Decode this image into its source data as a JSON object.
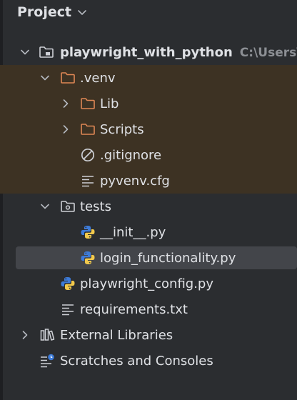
{
  "panel": {
    "title": "Project"
  },
  "tree": {
    "root": {
      "label": "playwright_with_python",
      "path_hint": "C:\\Users\\"
    },
    "venv": {
      "label": ".venv"
    },
    "lib": {
      "label": "Lib"
    },
    "scripts": {
      "label": "Scripts"
    },
    "gitignore": {
      "label": ".gitignore"
    },
    "pyvenv": {
      "label": "pyvenv.cfg"
    },
    "tests": {
      "label": "tests"
    },
    "init": {
      "label": "__init__.py"
    },
    "login": {
      "label": "login_functionality.py"
    },
    "playwright_config": {
      "label": "playwright_config.py"
    },
    "requirements": {
      "label": "requirements.txt"
    },
    "external_libraries": {
      "label": "External Libraries"
    },
    "scratches": {
      "label": "Scratches and Consoles"
    }
  },
  "colors": {
    "background": "#2b2d30",
    "excluded_highlight": "#3d3223",
    "selection": "#43454a",
    "folder_excluded": "#e08855",
    "python_blue": "#3d7bd9",
    "python_yellow": "#f2c94c"
  }
}
